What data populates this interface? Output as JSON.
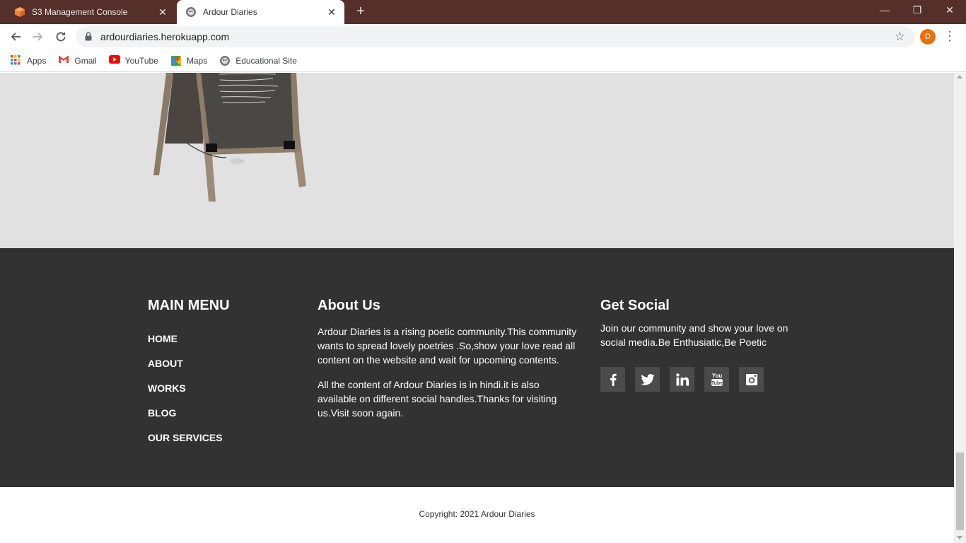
{
  "browser": {
    "tabs": [
      {
        "title": "S3 Management Console",
        "active": false,
        "icon": "aws-cube-icon"
      },
      {
        "title": "Ardour Diaries",
        "active": true,
        "icon": "ardour-diaries-favicon"
      }
    ],
    "url": "ardourdiaries.herokuapp.com",
    "profile_initial": "D",
    "bookmarks": [
      {
        "label": "Apps",
        "icon": "apps-grid-icon"
      },
      {
        "label": "Gmail",
        "icon": "gmail-icon"
      },
      {
        "label": "YouTube",
        "icon": "youtube-icon"
      },
      {
        "label": "Maps",
        "icon": "maps-icon"
      },
      {
        "label": "Educational Site",
        "icon": "educational-site-icon"
      }
    ],
    "colors": {
      "tabstrip": "#55302a",
      "omnibox": "#f1f3f4",
      "avatar": "#e8710a"
    }
  },
  "page": {
    "hero": {
      "image": "chalkboard-sign-illustration",
      "background": "#e1e1e1"
    },
    "footer": {
      "main_menu": {
        "title": "MAIN MENU",
        "links": [
          "HOME",
          "ABOUT",
          "WORKS",
          "BLOG",
          "OUR SERVICES"
        ]
      },
      "about": {
        "title": "About Us",
        "paragraphs": [
          "Ardour Diaries is a rising poetic community.This community wants to spread lovely poetries .So,show your love read all content on the website and wait for upcoming contents.",
          "All the content of Ardour Diaries is in hindi.it is also available on different social handles.Thanks for visiting us.Visit soon again."
        ]
      },
      "social": {
        "title": "Get Social",
        "text": "Join our community and show your love on social media.Be Enthusiatic,Be Poetic",
        "icons": [
          "facebook-icon",
          "twitter-icon",
          "linkedin-icon",
          "youtube-icon",
          "instagram-icon"
        ]
      },
      "background": "#333232"
    },
    "copyright": "Copyright: 2021 Ardour Diaries"
  }
}
